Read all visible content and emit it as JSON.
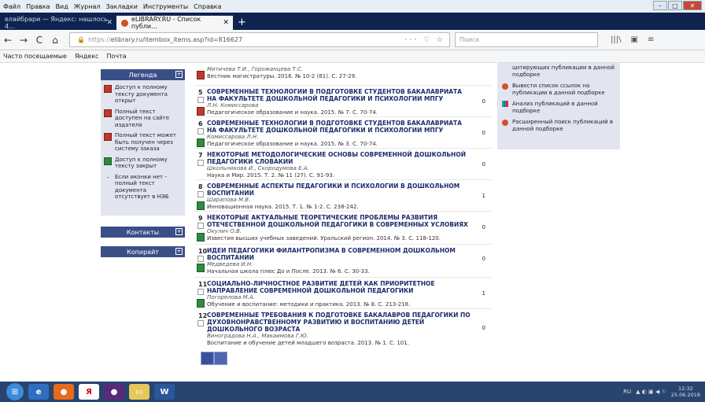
{
  "menu": [
    "Файл",
    "Правка",
    "Вид",
    "Журнал",
    "Закладки",
    "Инструменты",
    "Справка"
  ],
  "window_controls": [
    "–",
    "□",
    "✕"
  ],
  "tabs": [
    {
      "label": "елайбрари — Яндекс: нашлось 4…",
      "close": "✕"
    },
    {
      "label": "eLIBRARY.RU - Список публи…",
      "close": "✕"
    }
  ],
  "new_tab": "+",
  "nav": {
    "back": "←",
    "forward": "→",
    "reload": "C",
    "home": "⌂",
    "url_proto": "https://",
    "url_rest": "elibrary.ru/itembox_items.asp?id=816627",
    "url_icons": "··· ♡ ☆",
    "search_placeholder": "Поиск",
    "right_icons": [
      "|||\\",
      "▣",
      "≡"
    ]
  },
  "bookmarks": [
    "Часто посещаемые",
    "Яндекс",
    "Почта"
  ],
  "sidebar": {
    "legend_title": "Легенда",
    "legend": [
      {
        "icon": "pdf-red",
        "text": "Доступ к полному тексту документа открыт"
      },
      {
        "icon": "pdf-red",
        "text": "Полный текст доступен на сайте издателя"
      },
      {
        "icon": "pdf-red",
        "text": "Полный текст может быть получен через систему заказа"
      },
      {
        "icon": "pdf-green",
        "text": "Доступ к полному тексту закрыт"
      },
      {
        "icon": "dash",
        "text": "Если иконки нет - полный текст документа отсутствует в НЭБ"
      }
    ],
    "dash_glyph": "-",
    "contacts": "Контакты",
    "copyright": "Копирайт",
    "plus": "+"
  },
  "items": [
    {
      "num": "",
      "title": "",
      "authors": "Митичева Т.И., Горожанцева Т.С.",
      "source": "Вестник магистратуры. 2016. № 10-2 (61). С. 27-29.",
      "count": "0"
    },
    {
      "num": "5",
      "title": "Современные технологии в подготовке студентов бакалавриата на факультете дошкольной педагогики и психологии МПГУ",
      "authors": "Л.Н. Комиссарова",
      "source": "Педагогическое образование и наука. 2015. № 7. С. 70-74.",
      "count": "0"
    },
    {
      "num": "6",
      "title": "Современные технологии в подготовке студентов бакалавриата на факультете дошкольной педагогики и психологии МПГУ",
      "authors": "Комиссарова Л.Н.",
      "source": "Педагогическое образование и наука. 2015. № 3. С. 70-74.",
      "count": "0"
    },
    {
      "num": "7",
      "title": "Некоторые методологические основы современной дошкольной педагогики словакии",
      "authors": "Школьникова И., Скородумова Е.А.",
      "source": "Наука и Мир. 2015. Т. 2. № 11 (27). С. 91-93.",
      "count": "0"
    },
    {
      "num": "8",
      "title": "Современные аспекты педагогики и психологии в дошкольном воспитании",
      "authors": "Шарапова М.В.",
      "source": "Инновационная наука. 2015. Т. 1. № 1-2. С. 238-242.",
      "count": "1"
    },
    {
      "num": "9",
      "title": "Некоторые актуальные теоретические проблемы развития отечественной дошкольной педагогики в современных условиях",
      "authors": "Окулич О.В.",
      "source": "Известия высших учебных заведений. Уральский регион. 2014. № 3. С. 118-120.",
      "count": "0"
    },
    {
      "num": "10",
      "title": "Идеи педагогики филантропизма в современном дошкольном воспитании",
      "authors": "Медведева И.Н.",
      "source": "Начальная школа плюс До и После. 2013. № 6. С. 30-33.",
      "count": "0"
    },
    {
      "num": "11",
      "title": "Социально-личностное развитие детей как приоритетное направление современной дошкольной педагогики",
      "authors": "Погорелова М.А.",
      "source": "Обучение и воспитание: методики и практика. 2013. № 8. С. 213-218.",
      "count": "1"
    },
    {
      "num": "12",
      "title": "Современные требования к подготовке бакалавров педагогики по духовнонравственному развитию и воспитанию детей дошкольного возраста",
      "authors": "Виноградова Н.А., Макаимова Г.Ю.",
      "source": "Воспитание и обучение детей младшего возраста. 2013. № 1. С. 101.",
      "count": "0"
    }
  ],
  "right_panel": [
    {
      "icon": "dot",
      "text": "цитирующих публикации в данной подборке"
    },
    {
      "icon": "dot",
      "text": "Вывести список ссылок на публикации в данной подборке"
    },
    {
      "icon": "bars",
      "text": "Анализ публикаций в данной подборке"
    },
    {
      "icon": "dot",
      "text": "Расширенный поиск публикаций в данной подборке"
    }
  ],
  "taskbar": {
    "icons": [
      "e",
      "Я",
      "W"
    ],
    "lang": "RU",
    "time": "12:32",
    "date": "25.06.2018"
  }
}
